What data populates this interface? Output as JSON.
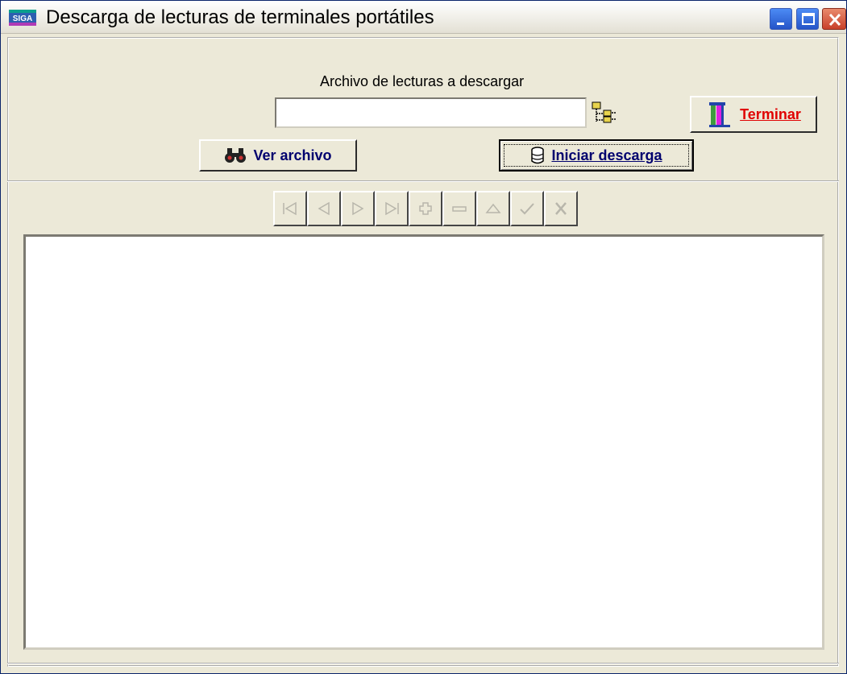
{
  "window": {
    "title": "Descarga de lecturas de terminales portátiles",
    "app_icon": "app-logo-icon",
    "controls": [
      "minimize-icon",
      "maximize-icon",
      "close-icon"
    ]
  },
  "form": {
    "file_label": "Archivo de lecturas a descargar",
    "file_value": "",
    "browse_icon": "folder-tree-icon",
    "ver_archivo_label": "Ver archivo",
    "ver_archivo_icon": "binoculars-icon",
    "iniciar_label": "Iniciar descarga",
    "iniciar_icon": "database-icon",
    "terminar_label": "Terminar",
    "terminar_icon": "door-exit-icon"
  },
  "navigator": {
    "buttons": [
      "first-icon",
      "prior-icon",
      "next-icon",
      "last-icon",
      "insert-icon",
      "delete-icon",
      "edit-icon",
      "post-icon",
      "cancel-icon"
    ],
    "enabled": false
  },
  "colors": {
    "face": "#ece9d8",
    "button_text": "#00006e",
    "terminar_text": "#e00000",
    "disabled_glyph": "#b8b6ab"
  }
}
